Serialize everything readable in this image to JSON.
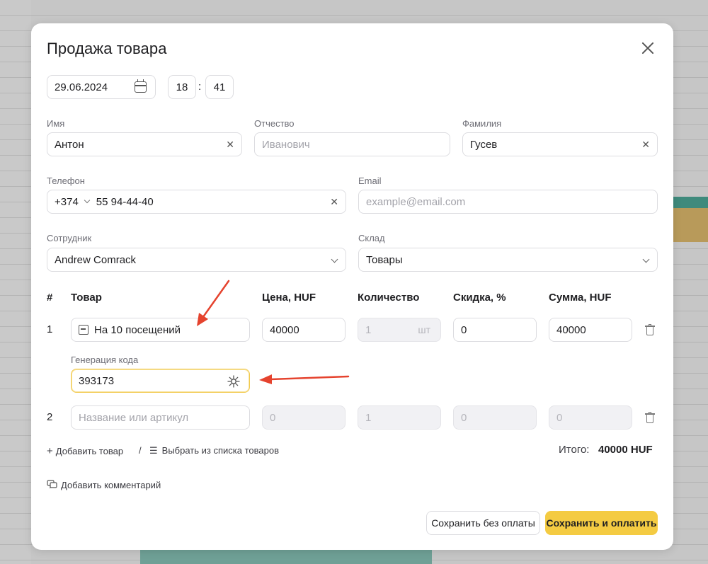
{
  "modal": {
    "title": "Продажа товара"
  },
  "datetime": {
    "date": "29.06.2024",
    "hour": "18",
    "separator": ":",
    "minute": "41"
  },
  "customer": {
    "first_name_label": "Имя",
    "first_name_value": "Антон",
    "middle_name_label": "Отчество",
    "middle_name_placeholder": "Иванович",
    "last_name_label": "Фамилия",
    "last_name_value": "Гусев",
    "phone_label": "Телефон",
    "phone_code": "+374",
    "phone_value": "55 94-44-40",
    "email_label": "Email",
    "email_placeholder": "example@email.com"
  },
  "assignment": {
    "employee_label": "Сотрудник",
    "employee_value": "Andrew Comrack",
    "warehouse_label": "Склад",
    "warehouse_value": "Товары"
  },
  "table": {
    "headers": {
      "num": "#",
      "product": "Товар",
      "price": "Цена, HUF",
      "quantity": "Количество",
      "discount": "Скидка, %",
      "sum": "Сумма, HUF"
    },
    "rows": [
      {
        "num": "1",
        "product": "На 10 посещений",
        "price": "40000",
        "quantity": "1",
        "unit": "шт",
        "discount": "0",
        "sum": "40000",
        "code_label": "Генерация кода",
        "code_value": "393173"
      },
      {
        "num": "2",
        "product_placeholder": "Название или артикул",
        "price_placeholder": "0",
        "quantity_placeholder": "1",
        "discount_placeholder": "0",
        "sum_placeholder": "0"
      }
    ]
  },
  "actions": {
    "add_product": "Добавить товар",
    "separator": "/",
    "choose_from_list": "Выбрать из списка товаров",
    "add_comment": "Добавить комментарий",
    "total_label": "Итого:",
    "total_value": "40000 HUF",
    "save_without_payment": "Сохранить без оплаты",
    "save_and_pay": "Сохранить и оплатить"
  },
  "colors": {
    "accent": "#f4cb42",
    "annotation_arrow": "#e5432e"
  },
  "icons": [
    "close-icon",
    "calendar-icon",
    "clear-icon",
    "chevron-down-icon",
    "box-icon",
    "refresh-code-icon",
    "trash-icon",
    "plus-icon",
    "list-icon",
    "comment-icon"
  ]
}
